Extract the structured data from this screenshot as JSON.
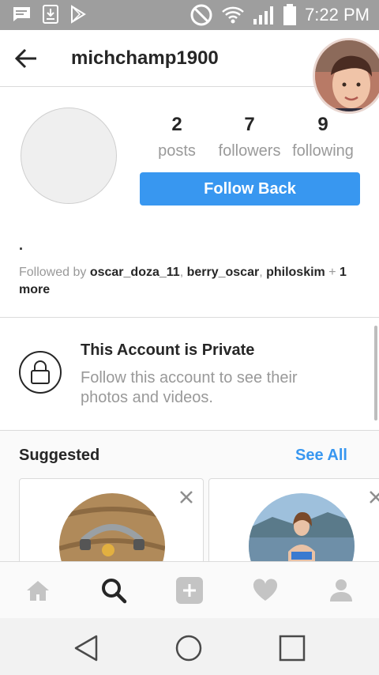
{
  "status_bar": {
    "time": "7:22 PM"
  },
  "header": {
    "username": "michchamp1900"
  },
  "profile": {
    "stats": [
      {
        "value": "2",
        "label": "posts"
      },
      {
        "value": "7",
        "label": "followers"
      },
      {
        "value": "9",
        "label": "following"
      }
    ],
    "follow_button_label": "Follow Back",
    "bio": ".",
    "followed_by": {
      "prefix": "Followed by ",
      "users": [
        "oscar_doza_11",
        "berry_oscar",
        "philoskim"
      ],
      "separator": ", ",
      "plus": " + ",
      "more": "1 more"
    }
  },
  "private_notice": {
    "title": "This Account is Private",
    "subtitle": "Follow this account to see their photos and videos."
  },
  "suggested": {
    "title": "Suggested",
    "see_all_label": "See All"
  },
  "colors": {
    "accent": "#3897f0",
    "status_bar": "#9e9e9e",
    "muted_text": "#999999"
  }
}
